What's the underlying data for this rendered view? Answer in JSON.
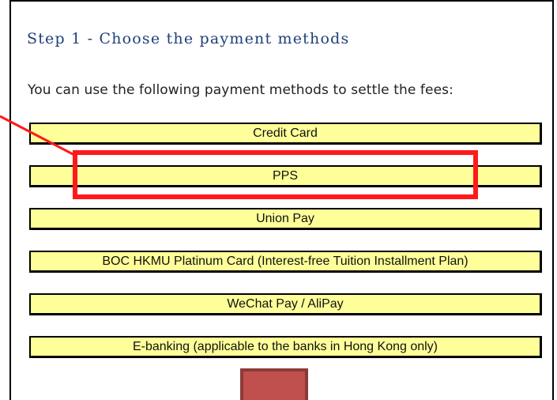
{
  "step": {
    "title": "Step 1 - Choose the payment methods",
    "intro": "You can use the following payment methods to settle the fees:"
  },
  "payment_methods": [
    {
      "label": "Credit Card"
    },
    {
      "label": "PPS"
    },
    {
      "label": "Union Pay"
    },
    {
      "label": "BOC HKMU Platinum Card (Interest-free Tuition Installment Plan)"
    },
    {
      "label": "WeChat Pay / AliPay"
    },
    {
      "label": "E-banking (applicable to the banks in Hong Kong only)"
    }
  ],
  "colors": {
    "button_fill": "#ffff99",
    "highlight": "#ff1a1a",
    "title_text": "#1f3f7a",
    "next_button": "#c0504d"
  },
  "annotation": {
    "highlighted_method": "PPS"
  }
}
